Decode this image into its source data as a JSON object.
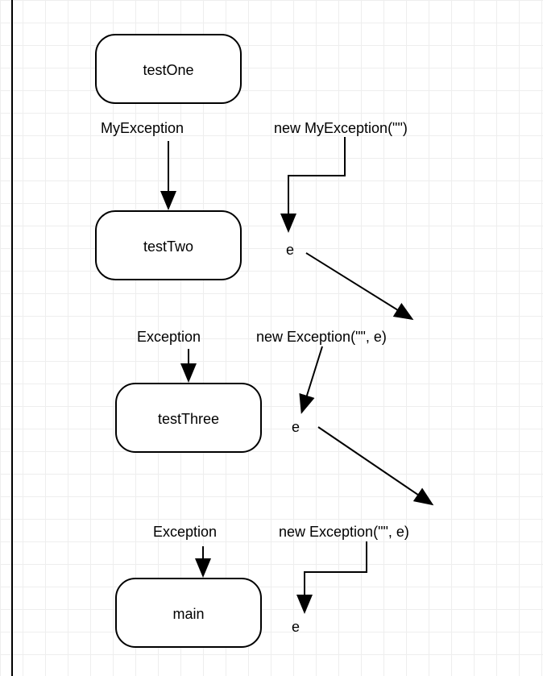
{
  "nodes": {
    "testOne": {
      "label": "testOne"
    },
    "testTwo": {
      "label": "testTwo"
    },
    "testThree": {
      "label": "testThree"
    },
    "main": {
      "label": "main"
    }
  },
  "edges": {
    "e1_left": "MyException",
    "e1_right": "new MyException(\"\")",
    "e2_e": "e",
    "e2_left": "Exception",
    "e2_right": "new Exception(\"\", e)",
    "e3_e": "e",
    "e3_left": "Exception",
    "e3_right": "new Exception(\"\", e)",
    "e4_e": "e"
  }
}
